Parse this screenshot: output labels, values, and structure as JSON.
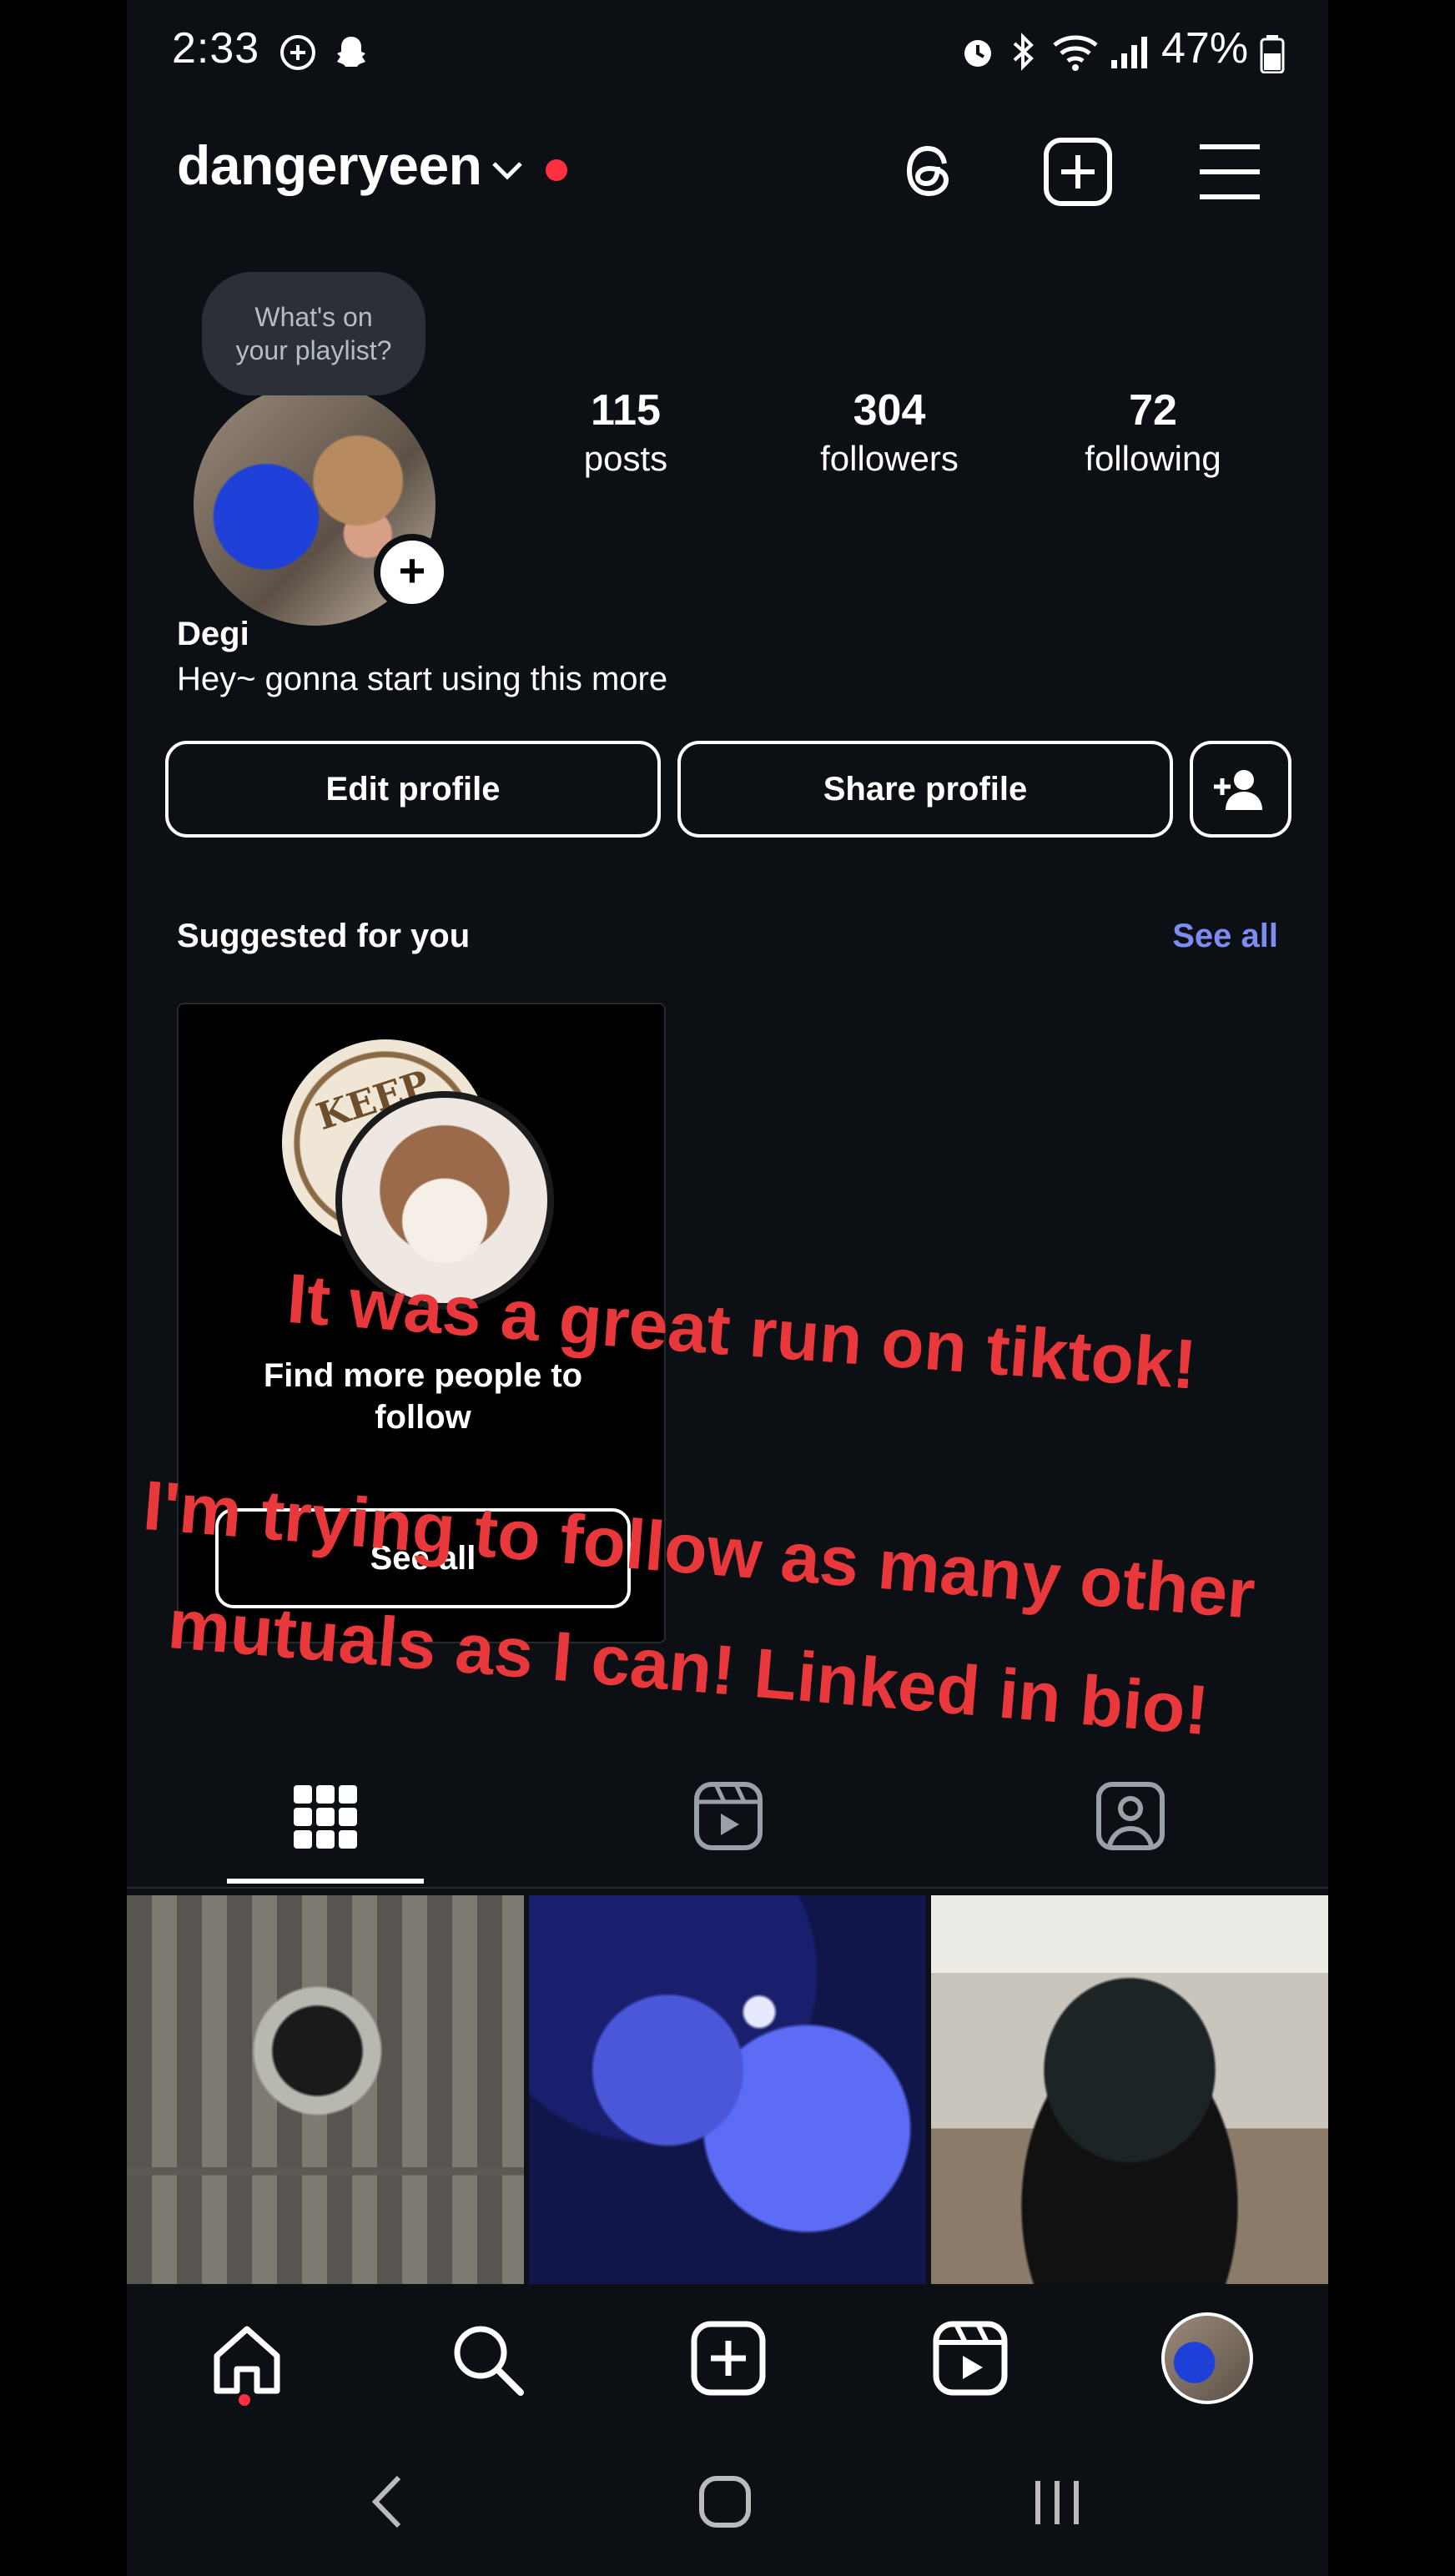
{
  "status_bar": {
    "time": "2:33",
    "battery": "47%"
  },
  "header": {
    "username": "dangeryeen"
  },
  "profile": {
    "note_bubble": [
      "What's on",
      "your playlist?"
    ],
    "stats": [
      {
        "value": "115",
        "label": "posts"
      },
      {
        "value": "304",
        "label": "followers"
      },
      {
        "value": "72",
        "label": "following"
      }
    ],
    "name": "Degi",
    "bio": "Hey~ gonna start using this more",
    "edit_label": "Edit profile",
    "share_label": "Share profile"
  },
  "suggested": {
    "title": "Suggested for you",
    "see_all": "See all",
    "card_text": [
      "Find more people to",
      "follow"
    ],
    "card_button": "See all",
    "badge_text": "KEEP"
  },
  "overlay": {
    "line1": "It was a great run on tiktok!",
    "line2": "I'm trying to follow as many other",
    "line3": "mutuals as I can! Linked in bio!"
  },
  "colors": {
    "accent_link": "#7c8cf0",
    "notification_dot": "#ff3040",
    "overlay_text": "#e8383b",
    "background": "#0c1014"
  },
  "icons": [
    "threads-icon",
    "new-post-icon",
    "menu-icon",
    "add-person-icon",
    "grid-icon",
    "reels-icon",
    "tagged-icon",
    "home-icon",
    "search-icon",
    "create-icon",
    "reels-nav-icon",
    "back-icon",
    "home-circle-icon",
    "recents-icon"
  ]
}
